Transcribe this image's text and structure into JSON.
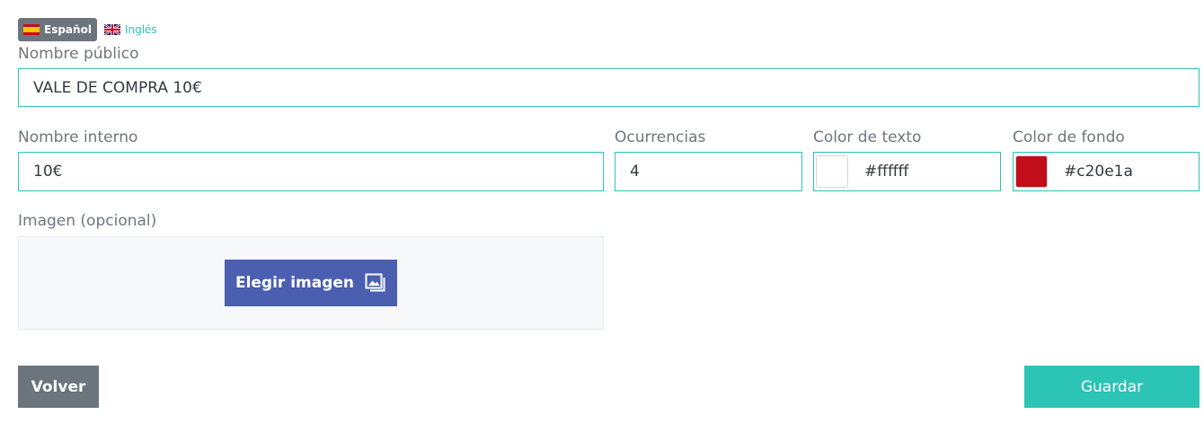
{
  "languages": [
    {
      "label": "Español",
      "active": true,
      "flag": "flag-spain-icon"
    },
    {
      "label": "Inglés",
      "active": false,
      "flag": "flag-uk-icon"
    }
  ],
  "public_name": {
    "label": "Nombre público",
    "value": "VALE DE COMPRA 10€"
  },
  "internal_name": {
    "label": "Nombre interno",
    "value": "10€"
  },
  "occurrences": {
    "label": "Ocurrencias",
    "value": "4"
  },
  "text_color": {
    "label": "Color de texto",
    "value": "#ffffff",
    "swatch": "#ffffff"
  },
  "bg_color": {
    "label": "Color de fondo",
    "value": "#c20e1a",
    "swatch": "#c20e1a"
  },
  "image": {
    "label": "Imagen (opcional)",
    "button_label": "Elegir imagen",
    "icon": "image-gallery-icon"
  },
  "actions": {
    "back_label": "Volver",
    "save_label": "Guardar"
  },
  "colors": {
    "accent": "#2cc4b4",
    "primary_button": "#4a5fb0",
    "secondary_button": "#6c757d"
  }
}
